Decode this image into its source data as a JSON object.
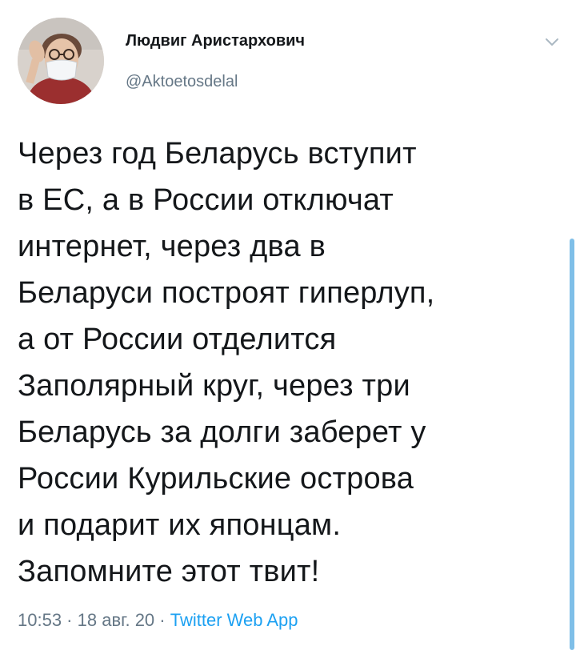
{
  "tweet": {
    "author": {
      "display_name": "Людвиг Аристархович",
      "handle": "@Aktoetosdelal"
    },
    "text": "Через год Беларусь вступит\nв ЕС, а в России отключат\nинтернет, через два в\nБеларуси построят гиперлуп,\nа от России отделится\nЗаполярный круг, через три\nБеларусь за долги заберет у\nРоссии Курильские острова\nи подарит их японцам.\nЗапомните этот твит!",
    "time": "10:53",
    "date": "18 авг. 20",
    "separator": " · ",
    "source": "Twitter Web App",
    "menu_icon": "chevron-down-icon"
  },
  "colors": {
    "text": "#14171a",
    "secondary": "#657786",
    "link": "#1da1f2",
    "scroll_indicator": "#7fbfe8"
  }
}
